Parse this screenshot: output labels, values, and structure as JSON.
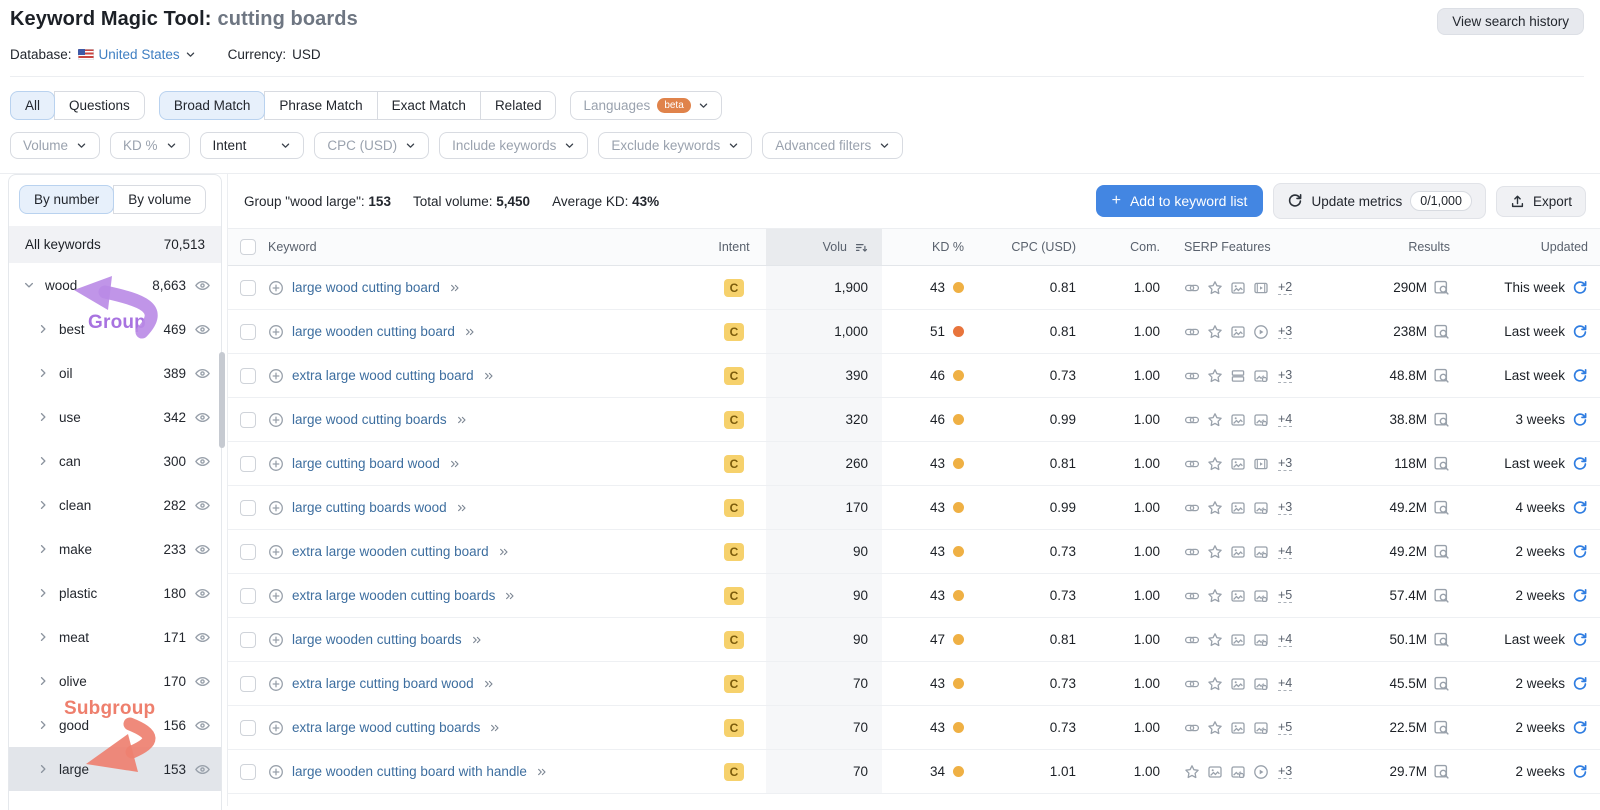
{
  "header": {
    "title": "Keyword Magic Tool:",
    "query": "cutting boards",
    "view_history_label": "View search history",
    "database_label": "Database:",
    "database_value": "United States",
    "currency_label": "Currency:",
    "currency_value": "USD"
  },
  "tabs": {
    "group1": [
      {
        "label": "All",
        "active": true
      },
      {
        "label": "Questions",
        "active": false
      }
    ],
    "group2": [
      {
        "label": "Broad Match",
        "active": true
      },
      {
        "label": "Phrase Match",
        "active": false
      },
      {
        "label": "Exact Match",
        "active": false
      },
      {
        "label": "Related",
        "active": false
      }
    ],
    "languages": {
      "label": "Languages",
      "badge": "beta"
    }
  },
  "filters": [
    {
      "label": "Volume",
      "dark": false
    },
    {
      "label": "KD %",
      "dark": false
    },
    {
      "label": "Intent",
      "dark": true,
      "wide": true
    },
    {
      "label": "CPC (USD)",
      "dark": false
    },
    {
      "label": "Include keywords",
      "dark": false
    },
    {
      "label": "Exclude keywords",
      "dark": false
    },
    {
      "label": "Advanced filters",
      "dark": false
    }
  ],
  "sidebar": {
    "toggle": [
      {
        "label": "By number",
        "active": true
      },
      {
        "label": "By volume",
        "active": false
      }
    ],
    "all_keywords": {
      "label": "All keywords",
      "count": "70,513"
    },
    "groups": [
      {
        "label": "wood",
        "count": "8,663",
        "expanded": true,
        "child": false,
        "selected": false
      },
      {
        "label": "best",
        "count": "469",
        "child": true,
        "selected": false
      },
      {
        "label": "oil",
        "count": "389",
        "child": true,
        "selected": false
      },
      {
        "label": "use",
        "count": "342",
        "child": true,
        "selected": false
      },
      {
        "label": "can",
        "count": "300",
        "child": true,
        "selected": false
      },
      {
        "label": "clean",
        "count": "282",
        "child": true,
        "selected": false
      },
      {
        "label": "make",
        "count": "233",
        "child": true,
        "selected": false
      },
      {
        "label": "plastic",
        "count": "180",
        "child": true,
        "selected": false
      },
      {
        "label": "meat",
        "count": "171",
        "child": true,
        "selected": false
      },
      {
        "label": "olive",
        "count": "170",
        "child": true,
        "selected": false
      },
      {
        "label": "good",
        "count": "156",
        "child": true,
        "selected": false
      },
      {
        "label": "large",
        "count": "153",
        "child": true,
        "selected": true
      }
    ],
    "annotations": {
      "group_label": "Group",
      "group_color": "#a873e0",
      "subgroup_label": "Subgroup",
      "subgroup_color": "#ee7f6d"
    }
  },
  "toolbar": {
    "group_label": "Group \"wood large\":",
    "group_count": "153",
    "total_volume_label": "Total volume:",
    "total_volume": "5,450",
    "avg_kd_label": "Average KD:",
    "avg_kd": "43%",
    "add_button_label": "Add to keyword list",
    "update_metrics_label": "Update metrics",
    "update_quota": "0/1,000",
    "export_label": "Export"
  },
  "table": {
    "columns": {
      "keyword": "Keyword",
      "intent": "Intent",
      "volume": "Volu",
      "kd": "KD %",
      "cpc": "CPC (USD)",
      "com": "Com.",
      "serp": "SERP Features",
      "results": "Results",
      "updated": "Updated"
    },
    "kd_colors": {
      "medium": "#efb044",
      "hard": "#e8743c"
    },
    "rows": [
      {
        "keyword": "large wood cutting board",
        "intent": "C",
        "volume": "1,900",
        "kd": "43",
        "kd_level": "medium",
        "cpc": "0.81",
        "com": "1.00",
        "serp": [
          "link",
          "star",
          "image",
          "video"
        ],
        "serp_more": "+2",
        "results": "290M",
        "updated": "This week"
      },
      {
        "keyword": "large wooden cutting board",
        "intent": "C",
        "volume": "1,000",
        "kd": "51",
        "kd_level": "hard",
        "cpc": "0.81",
        "com": "1.00",
        "serp": [
          "link",
          "star",
          "image",
          "play"
        ],
        "serp_more": "+3",
        "results": "238M",
        "updated": "Last week"
      },
      {
        "keyword": "extra large wood cutting board",
        "intent": "C",
        "volume": "390",
        "kd": "46",
        "kd_level": "medium",
        "cpc": "0.73",
        "com": "1.00",
        "serp": [
          "link",
          "star",
          "list",
          "imagepack"
        ],
        "serp_more": "+3",
        "results": "48.8M",
        "updated": "Last week"
      },
      {
        "keyword": "large wood cutting boards",
        "intent": "C",
        "volume": "320",
        "kd": "46",
        "kd_level": "medium",
        "cpc": "0.99",
        "com": "1.00",
        "serp": [
          "link",
          "star",
          "image",
          "imagepack"
        ],
        "serp_more": "+4",
        "results": "38.8M",
        "updated": "3 weeks"
      },
      {
        "keyword": "large cutting board wood",
        "intent": "C",
        "volume": "260",
        "kd": "43",
        "kd_level": "medium",
        "cpc": "0.81",
        "com": "1.00",
        "serp": [
          "link",
          "star",
          "image",
          "video"
        ],
        "serp_more": "+3",
        "results": "118M",
        "updated": "Last week"
      },
      {
        "keyword": "large cutting boards wood",
        "intent": "C",
        "volume": "170",
        "kd": "43",
        "kd_level": "medium",
        "cpc": "0.99",
        "com": "1.00",
        "serp": [
          "link",
          "star",
          "image",
          "imagepack"
        ],
        "serp_more": "+3",
        "results": "49.2M",
        "updated": "4 weeks"
      },
      {
        "keyword": "extra large wooden cutting board",
        "intent": "C",
        "volume": "90",
        "kd": "43",
        "kd_level": "medium",
        "cpc": "0.73",
        "com": "1.00",
        "serp": [
          "link",
          "star",
          "image",
          "imagepack"
        ],
        "serp_more": "+4",
        "results": "49.2M",
        "updated": "2 weeks"
      },
      {
        "keyword": "extra large wooden cutting boards",
        "intent": "C",
        "volume": "90",
        "kd": "43",
        "kd_level": "medium",
        "cpc": "0.73",
        "com": "1.00",
        "serp": [
          "link",
          "star",
          "image",
          "imagepack"
        ],
        "serp_more": "+5",
        "results": "57.4M",
        "updated": "2 weeks"
      },
      {
        "keyword": "large wooden cutting boards",
        "intent": "C",
        "volume": "90",
        "kd": "47",
        "kd_level": "medium",
        "cpc": "0.81",
        "com": "1.00",
        "serp": [
          "link",
          "star",
          "image",
          "imagepack"
        ],
        "serp_more": "+4",
        "results": "50.1M",
        "updated": "Last week"
      },
      {
        "keyword": "extra large cutting board wood",
        "intent": "C",
        "volume": "70",
        "kd": "43",
        "kd_level": "medium",
        "cpc": "0.73",
        "com": "1.00",
        "serp": [
          "link",
          "star",
          "image",
          "imagepack"
        ],
        "serp_more": "+4",
        "results": "45.5M",
        "updated": "2 weeks"
      },
      {
        "keyword": "extra large wood cutting boards",
        "intent": "C",
        "volume": "70",
        "kd": "43",
        "kd_level": "medium",
        "cpc": "0.73",
        "com": "1.00",
        "serp": [
          "link",
          "star",
          "image",
          "imagepack"
        ],
        "serp_more": "+5",
        "results": "22.5M",
        "updated": "2 weeks"
      },
      {
        "keyword": "large wooden cutting board with handle",
        "intent": "C",
        "volume": "70",
        "kd": "34",
        "kd_level": "medium",
        "cpc": "1.01",
        "com": "1.00",
        "serp": [
          "star",
          "image",
          "imagepack",
          "play"
        ],
        "serp_more": "+3",
        "results": "29.7M",
        "updated": "2 weeks"
      }
    ]
  }
}
